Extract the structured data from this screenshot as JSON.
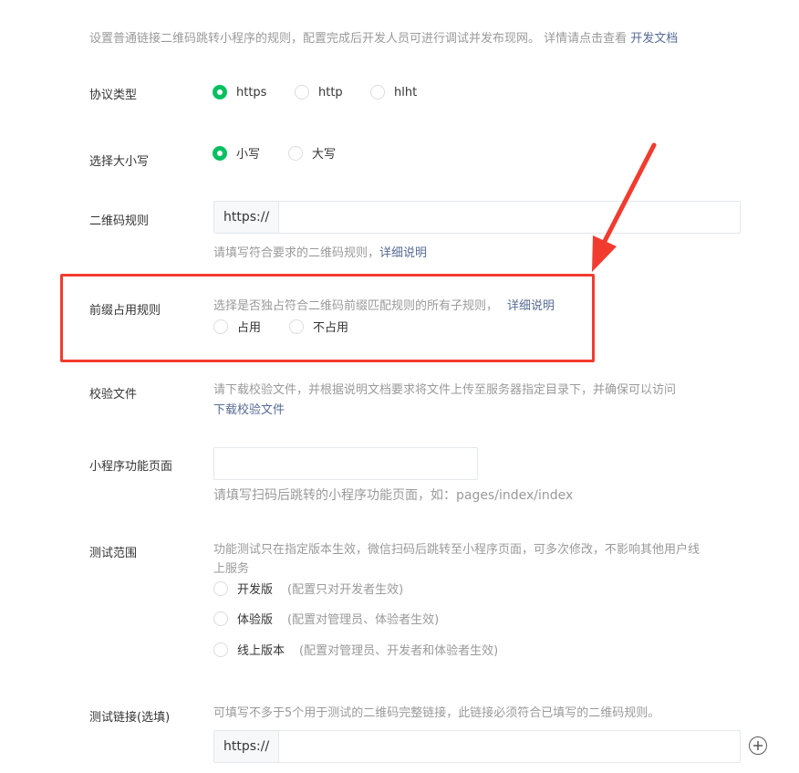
{
  "intro": {
    "text": "设置普通链接二维码跳转小程序的规则，配置完成后开发人员可进行调试并发布现网。 详情请点击查看 ",
    "link": "开发文档"
  },
  "protocol": {
    "label": "协议类型",
    "options": [
      "https",
      "http",
      "hlht"
    ],
    "selected": "https"
  },
  "case": {
    "label": "选择大小写",
    "options": [
      "小写",
      "大写"
    ],
    "selected": "小写"
  },
  "qr_rule": {
    "label": "二维码规则",
    "prefix": "https://",
    "value": "",
    "hint": "请填写符合要求的二维码规则，",
    "hint_link": "详细说明"
  },
  "prefix_rule": {
    "label": "前缀占用规则",
    "desc": "选择是否独占符合二维码前缀匹配规则的所有子规则，",
    "desc_link": "详细说明",
    "options": [
      "占用",
      "不占用"
    ],
    "selected": null
  },
  "verify_file": {
    "label": "校验文件",
    "desc": "请下载校验文件，并根据说明文档要求将文件上传至服务器指定目录下，并确保可以访问",
    "link": "下载校验文件"
  },
  "page": {
    "label": "小程序功能页面",
    "value": "",
    "hint": "请填写扫码后跳转的小程序功能页面，如：pages/index/index"
  },
  "test_scope": {
    "label": "测试范围",
    "desc_line1": "功能测试只在指定版本生效，微信扫码后跳转至小程序页面，可多次修改，不影响其他用户线",
    "desc_line2": "上服务",
    "options": [
      {
        "name": "开发版",
        "note": "(配置只对开发者生效)"
      },
      {
        "name": "体验版",
        "note": "(配置对管理员、体验者生效)"
      },
      {
        "name": "线上版本",
        "note": "(配置对管理员、开发者和体验者生效)"
      }
    ]
  },
  "test_link": {
    "label": "测试链接(选填)",
    "desc": "可填写不多于5个用于测试的二维码完整链接，此链接必须符合已填写的二维码规则。",
    "prefix": "https://",
    "value": ""
  },
  "colors": {
    "accent": "#07c160",
    "link": "#576b95",
    "annotation": "#f23b2f"
  },
  "icons": {
    "add": "plus-circle-icon",
    "annotation": "red-arrow-icon"
  }
}
